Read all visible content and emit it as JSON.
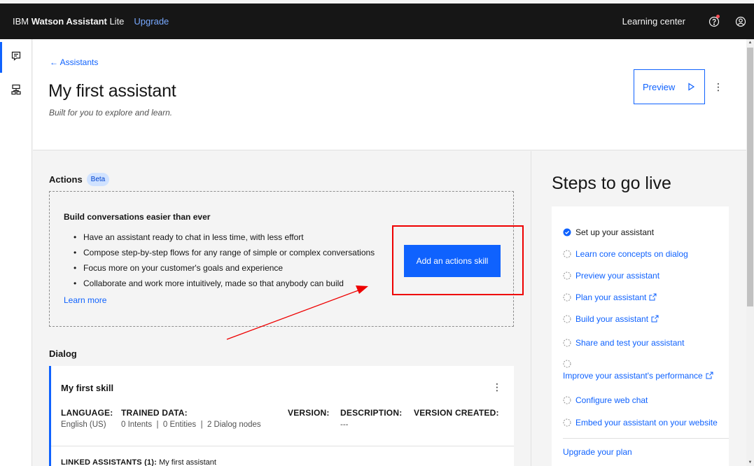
{
  "topbar": {
    "brand_prefix": "IBM ",
    "brand_bold": "Watson Assistant",
    "brand_suffix": " Lite",
    "upgrade": "Upgrade",
    "learning_center": "Learning center",
    "help_icon": "help-icon",
    "user_icon": "user-avatar-icon"
  },
  "rail": {
    "items": [
      {
        "icon": "chat-icon",
        "active": true
      },
      {
        "icon": "tree-view-icon",
        "active": false
      }
    ]
  },
  "header": {
    "back": "← Assistants",
    "title": "My first assistant",
    "subtitle": "Built for you to explore and learn.",
    "preview": "Preview"
  },
  "actions": {
    "heading": "Actions",
    "badge": "Beta",
    "box_title": "Build conversations easier than ever",
    "bullets": [
      "Have an assistant ready to chat in less time, with less effort",
      "Compose step-by-step flows for any range of simple or complex conversations",
      "Focus more on your customer's goals and experience",
      "Collaborate and work more intuitively, made so that anybody can build"
    ],
    "learn_more": "Learn more",
    "add_button": "Add an actions skill"
  },
  "dialog": {
    "heading": "Dialog",
    "skill": {
      "title": "My first skill",
      "language_label": "LANGUAGE:",
      "language_value": "English (US)",
      "trained_label": "TRAINED DATA:",
      "trained_value": "0 Intents  |  0 Entities  |  2 Dialog nodes",
      "version_label": "VERSION:",
      "version_value": "",
      "description_label": "DESCRIPTION:",
      "description_value": "---",
      "created_label": "VERSION CREATED:",
      "created_value": "",
      "linked_label": "LINKED ASSISTANTS (1):",
      "linked_value": " My first assistant"
    }
  },
  "steps": {
    "title": "Steps to go live",
    "items": [
      {
        "label": "Set up your assistant",
        "done": true,
        "external": false
      },
      {
        "label": "Learn core concepts on dialog",
        "done": false,
        "external": false
      },
      {
        "label": "Preview your assistant",
        "done": false,
        "external": false
      },
      {
        "label": "Plan your assistant",
        "done": false,
        "external": true
      },
      {
        "label": "Build your assistant",
        "done": false,
        "external": true
      },
      {
        "label": "Share and test your assistant",
        "done": false,
        "external": false
      },
      {
        "label": "Improve your assistant's performance",
        "done": false,
        "external": true
      },
      {
        "label": "Configure web chat",
        "done": false,
        "external": false
      },
      {
        "label": "Embed your assistant on your website",
        "done": false,
        "external": false
      }
    ],
    "upgrade_plan": "Upgrade your plan"
  },
  "colors": {
    "accent": "#0f62fe",
    "topbar": "#161616",
    "annotation": "#ee0000"
  }
}
